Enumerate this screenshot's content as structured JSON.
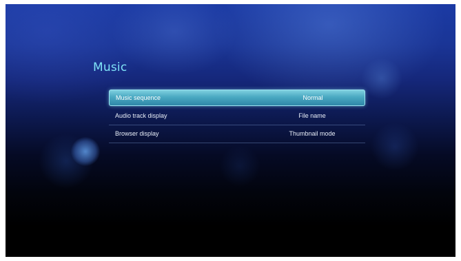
{
  "page": {
    "title": "Music"
  },
  "settings": [
    {
      "label": "Music sequence",
      "value": "Normal",
      "selected": true
    },
    {
      "label": "Audio track display",
      "value": "File name",
      "selected": false
    },
    {
      "label": "Browser display",
      "value": "Thumbnail mode",
      "selected": false
    }
  ],
  "colors": {
    "title": "#7fe3f7",
    "selection_highlight": "#4aa9c2",
    "text": "#e8eef8"
  }
}
